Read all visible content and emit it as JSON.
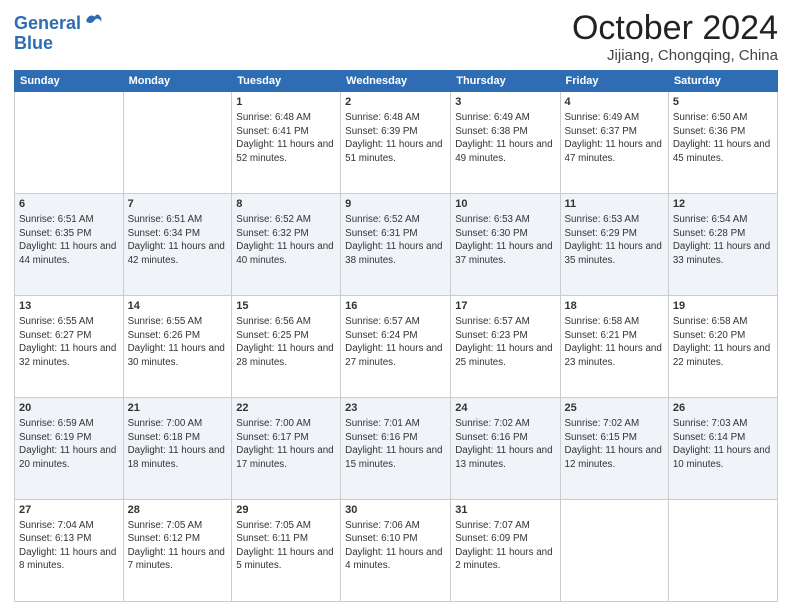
{
  "header": {
    "logo_line1": "General",
    "logo_line2": "Blue",
    "month_title": "October 2024",
    "location": "Jijiang, Chongqing, China"
  },
  "weekdays": [
    "Sunday",
    "Monday",
    "Tuesday",
    "Wednesday",
    "Thursday",
    "Friday",
    "Saturday"
  ],
  "weeks": [
    [
      {
        "day": "",
        "info": ""
      },
      {
        "day": "",
        "info": ""
      },
      {
        "day": "1",
        "info": "Sunrise: 6:48 AM\nSunset: 6:41 PM\nDaylight: 11 hours and 52 minutes."
      },
      {
        "day": "2",
        "info": "Sunrise: 6:48 AM\nSunset: 6:39 PM\nDaylight: 11 hours and 51 minutes."
      },
      {
        "day": "3",
        "info": "Sunrise: 6:49 AM\nSunset: 6:38 PM\nDaylight: 11 hours and 49 minutes."
      },
      {
        "day": "4",
        "info": "Sunrise: 6:49 AM\nSunset: 6:37 PM\nDaylight: 11 hours and 47 minutes."
      },
      {
        "day": "5",
        "info": "Sunrise: 6:50 AM\nSunset: 6:36 PM\nDaylight: 11 hours and 45 minutes."
      }
    ],
    [
      {
        "day": "6",
        "info": "Sunrise: 6:51 AM\nSunset: 6:35 PM\nDaylight: 11 hours and 44 minutes."
      },
      {
        "day": "7",
        "info": "Sunrise: 6:51 AM\nSunset: 6:34 PM\nDaylight: 11 hours and 42 minutes."
      },
      {
        "day": "8",
        "info": "Sunrise: 6:52 AM\nSunset: 6:32 PM\nDaylight: 11 hours and 40 minutes."
      },
      {
        "day": "9",
        "info": "Sunrise: 6:52 AM\nSunset: 6:31 PM\nDaylight: 11 hours and 38 minutes."
      },
      {
        "day": "10",
        "info": "Sunrise: 6:53 AM\nSunset: 6:30 PM\nDaylight: 11 hours and 37 minutes."
      },
      {
        "day": "11",
        "info": "Sunrise: 6:53 AM\nSunset: 6:29 PM\nDaylight: 11 hours and 35 minutes."
      },
      {
        "day": "12",
        "info": "Sunrise: 6:54 AM\nSunset: 6:28 PM\nDaylight: 11 hours and 33 minutes."
      }
    ],
    [
      {
        "day": "13",
        "info": "Sunrise: 6:55 AM\nSunset: 6:27 PM\nDaylight: 11 hours and 32 minutes."
      },
      {
        "day": "14",
        "info": "Sunrise: 6:55 AM\nSunset: 6:26 PM\nDaylight: 11 hours and 30 minutes."
      },
      {
        "day": "15",
        "info": "Sunrise: 6:56 AM\nSunset: 6:25 PM\nDaylight: 11 hours and 28 minutes."
      },
      {
        "day": "16",
        "info": "Sunrise: 6:57 AM\nSunset: 6:24 PM\nDaylight: 11 hours and 27 minutes."
      },
      {
        "day": "17",
        "info": "Sunrise: 6:57 AM\nSunset: 6:23 PM\nDaylight: 11 hours and 25 minutes."
      },
      {
        "day": "18",
        "info": "Sunrise: 6:58 AM\nSunset: 6:21 PM\nDaylight: 11 hours and 23 minutes."
      },
      {
        "day": "19",
        "info": "Sunrise: 6:58 AM\nSunset: 6:20 PM\nDaylight: 11 hours and 22 minutes."
      }
    ],
    [
      {
        "day": "20",
        "info": "Sunrise: 6:59 AM\nSunset: 6:19 PM\nDaylight: 11 hours and 20 minutes."
      },
      {
        "day": "21",
        "info": "Sunrise: 7:00 AM\nSunset: 6:18 PM\nDaylight: 11 hours and 18 minutes."
      },
      {
        "day": "22",
        "info": "Sunrise: 7:00 AM\nSunset: 6:17 PM\nDaylight: 11 hours and 17 minutes."
      },
      {
        "day": "23",
        "info": "Sunrise: 7:01 AM\nSunset: 6:16 PM\nDaylight: 11 hours and 15 minutes."
      },
      {
        "day": "24",
        "info": "Sunrise: 7:02 AM\nSunset: 6:16 PM\nDaylight: 11 hours and 13 minutes."
      },
      {
        "day": "25",
        "info": "Sunrise: 7:02 AM\nSunset: 6:15 PM\nDaylight: 11 hours and 12 minutes."
      },
      {
        "day": "26",
        "info": "Sunrise: 7:03 AM\nSunset: 6:14 PM\nDaylight: 11 hours and 10 minutes."
      }
    ],
    [
      {
        "day": "27",
        "info": "Sunrise: 7:04 AM\nSunset: 6:13 PM\nDaylight: 11 hours and 8 minutes."
      },
      {
        "day": "28",
        "info": "Sunrise: 7:05 AM\nSunset: 6:12 PM\nDaylight: 11 hours and 7 minutes."
      },
      {
        "day": "29",
        "info": "Sunrise: 7:05 AM\nSunset: 6:11 PM\nDaylight: 11 hours and 5 minutes."
      },
      {
        "day": "30",
        "info": "Sunrise: 7:06 AM\nSunset: 6:10 PM\nDaylight: 11 hours and 4 minutes."
      },
      {
        "day": "31",
        "info": "Sunrise: 7:07 AM\nSunset: 6:09 PM\nDaylight: 11 hours and 2 minutes."
      },
      {
        "day": "",
        "info": ""
      },
      {
        "day": "",
        "info": ""
      }
    ]
  ]
}
